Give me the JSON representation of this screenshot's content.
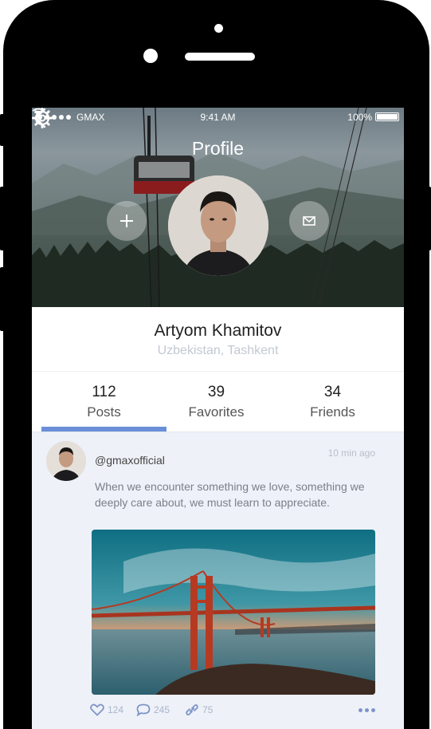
{
  "status_bar": {
    "carrier": "GMAX",
    "time": "9:41 AM",
    "battery": "100%",
    "signal_icon": "signal-dots-icon",
    "wifi_icon": "wifi-icon",
    "battery_icon": "battery-icon"
  },
  "nav": {
    "title": "Profile",
    "back_icon": "chevron-left-icon",
    "settings_icon": "gear-icon"
  },
  "profile": {
    "name": "Artyom Khamitov",
    "location": "Uzbekistan, Tashkent",
    "add_icon": "plus-icon",
    "message_icon": "mail-icon"
  },
  "stats": [
    {
      "value": "112",
      "label": "Posts"
    },
    {
      "value": "39",
      "label": "Favorites"
    },
    {
      "value": "34",
      "label": "Friends"
    }
  ],
  "selected_tab": "Posts",
  "post": {
    "handle": "@gmaxofficial",
    "time": "10 min ago",
    "text": "When we encounter something we love, something we deeply care about, we must learn to appreciate.",
    "likes": "124",
    "comments": "245",
    "shares": "75",
    "like_icon": "heart-icon",
    "comment_icon": "comment-icon",
    "share_icon": "link-icon",
    "more_icon": "more-dots-icon"
  },
  "colors": {
    "accent": "#6a8fd8",
    "feed_background": "#eef1f8",
    "muted_text": "#c3c8d2"
  }
}
